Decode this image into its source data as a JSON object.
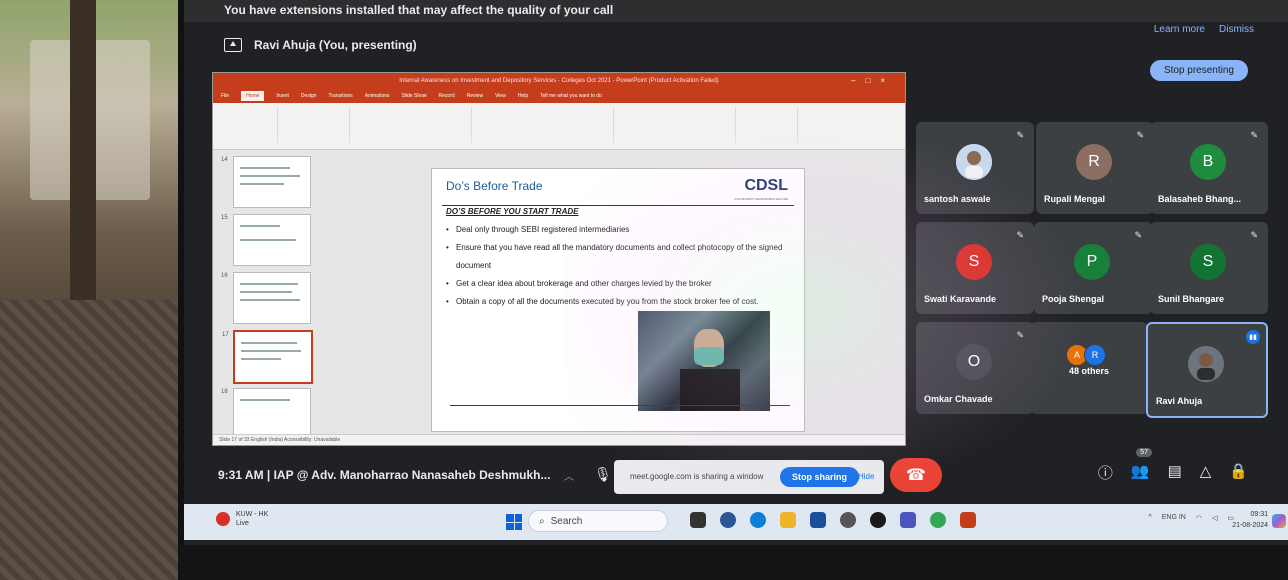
{
  "banner": {
    "message": "You have extensions installed that may affect the quality of your call",
    "learn_more": "Learn more",
    "dismiss": "Dismiss"
  },
  "presenter": {
    "label": "Ravi Ahuja (You, presenting)",
    "stop_presenting": "Stop presenting"
  },
  "powerpoint": {
    "window_title": "Internal Awareness on Investment and Depository Services - Colleges Oct 2021 - PowerPoint (Product Activation Failed)",
    "tabs": [
      "File",
      "Home",
      "Insert",
      "Design",
      "Transitions",
      "Animations",
      "Slide Show",
      "Record",
      "Review",
      "View",
      "Help",
      "Tell me what you want to do"
    ],
    "thumbnail_numbers": [
      "14",
      "15",
      "16",
      "17",
      "18"
    ],
    "status": "Slide 17 of 33     English (India)     Accessibility: Unavailable",
    "slide": {
      "title": "Do’s Before Trade",
      "logo": "CDSL",
      "logo_tagline": "CONVENIENT  DEPENDABLE  SECURE",
      "subtitle": "DO’S BEFORE YOU START TRADE",
      "bullets": [
        "Deal only through SEBI registered intermediaries",
        "Ensure that you have read all the mandatory documents and collect photocopy of the signed document",
        "Get a clear idea about brokerage and other charges levied by the broker",
        "Obtain a copy of all the documents executed by you from the stock broker fee of cost."
      ]
    }
  },
  "participants": [
    {
      "name": "santosh aswale",
      "initial": "",
      "color": "#8ab4f8",
      "photo": true
    },
    {
      "name": "Rupali Mengal",
      "initial": "R",
      "color": "#8d6e63"
    },
    {
      "name": "Balasaheb Bhang...",
      "initial": "B",
      "color": "#1e8e3e"
    },
    {
      "name": "Swati Karavande",
      "initial": "S",
      "color": "#d93025"
    },
    {
      "name": "Pooja Shengal",
      "initial": "P",
      "color": "#188038"
    },
    {
      "name": "Sunil Bhangare",
      "initial": "S",
      "color": "#137333"
    },
    {
      "name": "Omkar Chavade",
      "initial": "O",
      "color": "#3c4043"
    },
    {
      "name": "48 others",
      "others": true,
      "mini": [
        "A",
        "R"
      ]
    },
    {
      "name": "Ravi Ahuja",
      "self": true
    }
  ],
  "meeting": {
    "time_title": "9:31 AM  |  IAP @ Adv. Manoharrao Nanasaheb Deshmukh...",
    "sharing_text": "meet.google.com is sharing a window",
    "stop_sharing": "Stop sharing",
    "hide": "Hide",
    "people_count": "57"
  },
  "taskbar": {
    "weather_title": "KUW - HK",
    "weather_sub": "Live",
    "search_placeholder": "Search",
    "lang": "ENG IN",
    "time": "09:31",
    "date": "21-08-2024"
  }
}
